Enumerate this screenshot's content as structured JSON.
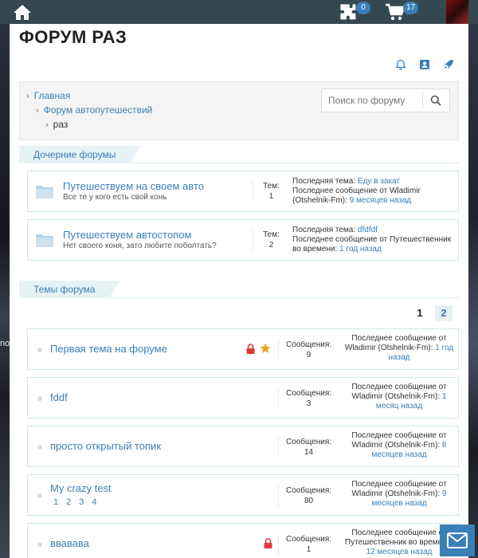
{
  "background": {
    "left_label": "no"
  },
  "topbar": {
    "notifications_count": "0",
    "cart_count": "17"
  },
  "page": {
    "title": "ФОРУМ РАЗ"
  },
  "breadcrumb": {
    "items": [
      "Главная",
      "Форум автопутешествий",
      "раз"
    ]
  },
  "search": {
    "placeholder": "Поиск по форуму"
  },
  "subforums_section": {
    "title": "Дочерние форумы",
    "items": [
      {
        "name": "Путешествуем на своем авто",
        "desc": "Все те у кого есть свой конь",
        "count_label": "Тем:",
        "count": "1",
        "last_topic_label": "Последняя тема:",
        "last_topic": "Еду в закат",
        "last_msg_label": "Последнее сообщение от Wladimir (Otshelnik-Fm):",
        "last_time": "9 месяцев назад"
      },
      {
        "name": "Путешествуем автостопом",
        "desc": "Нет своего коня, зато любите поболтать?",
        "count_label": "Тем:",
        "count": "2",
        "last_topic_label": "Последняя тема:",
        "last_topic": "dfdfdf",
        "last_msg_label": "Последнее сообщение от Путешественник во времени:",
        "last_time": "1 год назад"
      }
    ]
  },
  "topics_section": {
    "title": "Темы форума",
    "pages": [
      "1",
      "2"
    ],
    "items": [
      {
        "name": "Первая тема на форуме",
        "count_label": "Сообщения:",
        "count": "9",
        "last_label": "Последнее сообщение от Wladimir (Otshelnik-Fm):",
        "last_time": "1 год назад",
        "locked": true,
        "starred": true
      },
      {
        "name": "fddf",
        "count_label": "Сообщения:",
        "count": "3",
        "last_label": "Последнее сообщение от Wladimir (Otshelnik-Fm):",
        "last_time": "1 месяц назад",
        "locked": false,
        "starred": false
      },
      {
        "name": "просто открытый топик",
        "count_label": "Сообщения:",
        "count": "14",
        "last_label": "Последнее сообщение от Wladimir (Otshelnik-Fm):",
        "last_time": "8 месяцев назад",
        "locked": false,
        "starred": false
      },
      {
        "name": "My crazy test",
        "count_label": "Сообщения:",
        "count": "80",
        "last_label": "Последнее сообщение от Wladimir (Otshelnik-Fm):",
        "last_time": "9 месяцев назад",
        "locked": false,
        "starred": false,
        "pages": [
          "1",
          "2",
          "3",
          "4"
        ]
      },
      {
        "name": "ввавава",
        "count_label": "Сообщения:",
        "count": "1",
        "last_label": "Последнее сообщение от Путешественник во времени:",
        "last_time": "12 месяцев назад",
        "locked": true,
        "starred": false
      }
    ]
  },
  "colors": {
    "topbar": "#33494f",
    "accent": "#3a7fb8",
    "lock": "#e03a3a",
    "star": "#f0a020"
  }
}
